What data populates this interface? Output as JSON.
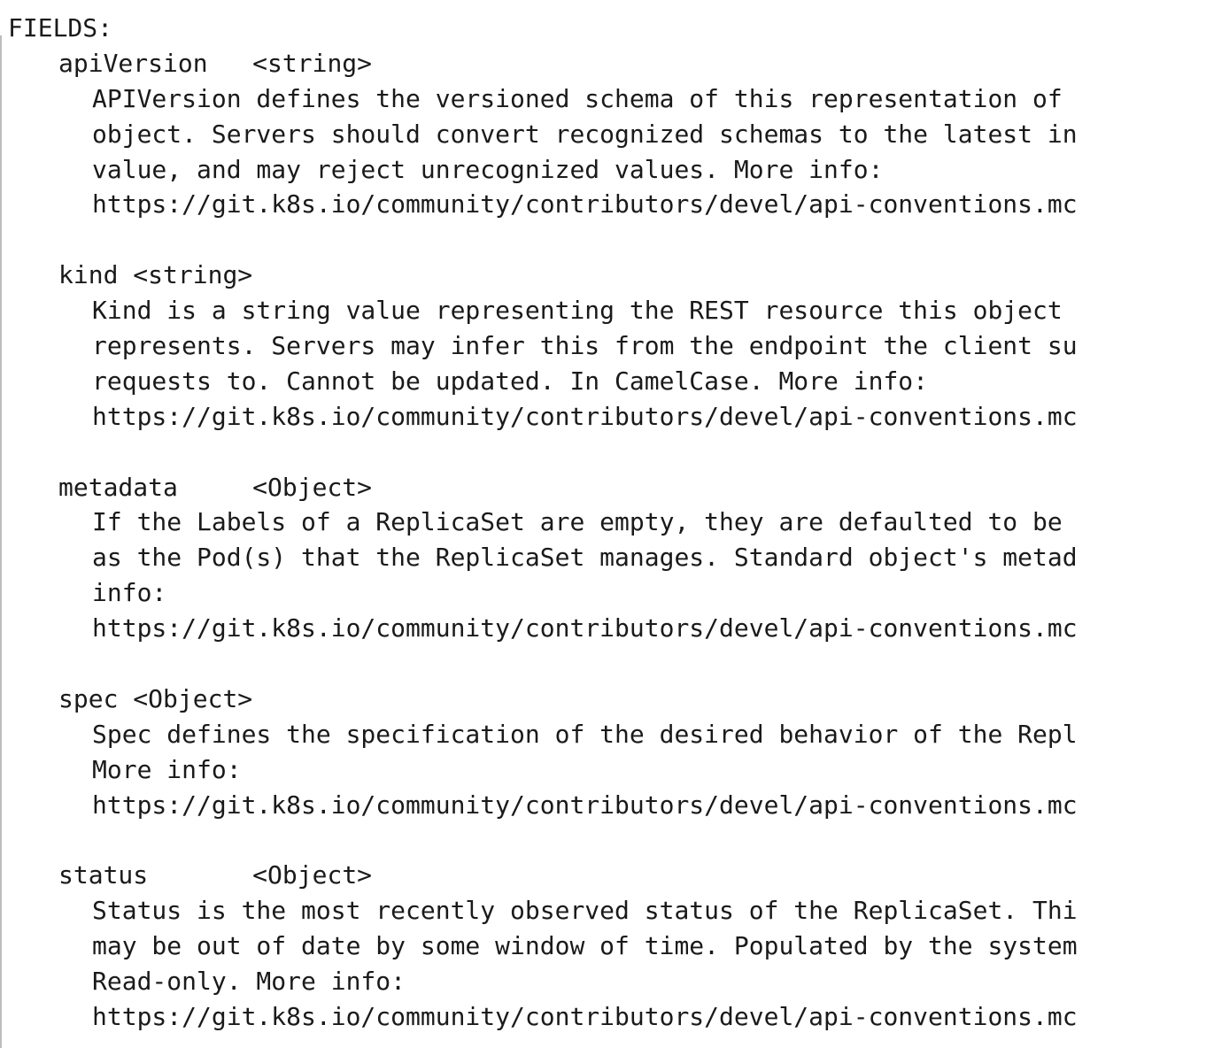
{
  "header": "FIELDS:",
  "fields": [
    {
      "name": "apiVersion",
      "gap": "   ",
      "type": "<string>",
      "desc": [
        "APIVersion defines the versioned schema of this representation of",
        "object. Servers should convert recognized schemas to the latest in",
        "value, and may reject unrecognized values. More info:",
        "https://git.k8s.io/community/contributors/devel/api-conventions.mc"
      ]
    },
    {
      "name": "kind",
      "gap": " ",
      "type": "<string>",
      "desc": [
        "Kind is a string value representing the REST resource this object",
        "represents. Servers may infer this from the endpoint the client su",
        "requests to. Cannot be updated. In CamelCase. More info:",
        "https://git.k8s.io/community/contributors/devel/api-conventions.mc"
      ]
    },
    {
      "name": "metadata",
      "gap": "     ",
      "type": "<Object>",
      "desc": [
        "If the Labels of a ReplicaSet are empty, they are defaulted to be",
        "as the Pod(s) that the ReplicaSet manages. Standard object's metad",
        "info:",
        "https://git.k8s.io/community/contributors/devel/api-conventions.mc"
      ]
    },
    {
      "name": "spec",
      "gap": " ",
      "type": "<Object>",
      "desc": [
        "Spec defines the specification of the desired behavior of the Repl",
        "More info:",
        "https://git.k8s.io/community/contributors/devel/api-conventions.mc"
      ]
    },
    {
      "name": "status",
      "gap": "       ",
      "type": "<Object>",
      "desc": [
        "Status is the most recently observed status of the ReplicaSet. Thi",
        "may be out of date by some window of time. Populated by the system",
        "Read-only. More info:",
        "https://git.k8s.io/community/contributors/devel/api-conventions.mc"
      ]
    }
  ]
}
